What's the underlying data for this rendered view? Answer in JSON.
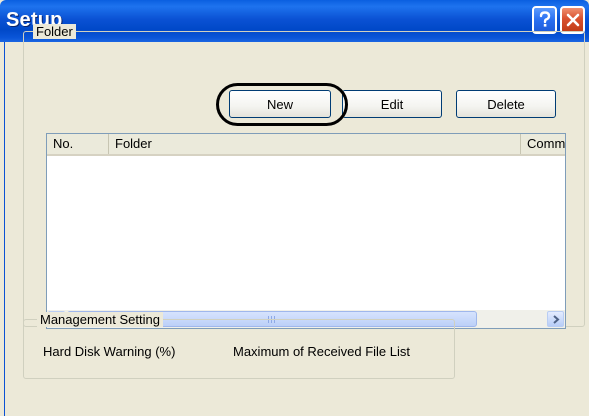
{
  "window": {
    "title": "Setup",
    "help_label": "?",
    "close_label": "X"
  },
  "folder_group": {
    "label": "Folder",
    "buttons": {
      "new": "New",
      "edit": "Edit",
      "delete": "Delete"
    },
    "list": {
      "columns": [
        "No.",
        "Folder",
        "Comment"
      ],
      "rows": []
    }
  },
  "management_group": {
    "label": "Management Setting",
    "hard_disk_warning_label": "Hard Disk Warning (%)",
    "max_received_label": "Maximum of Received File List"
  },
  "icons": {
    "help": "question-icon",
    "close": "close-icon",
    "scroll_left": "chevron-left-icon",
    "scroll_right": "chevron-right-icon"
  },
  "colors": {
    "titlebar": "#0b52d4",
    "close_button": "#d9512e",
    "help_button": "#2a6ff0",
    "dialog_bg": "#ece9d8"
  }
}
